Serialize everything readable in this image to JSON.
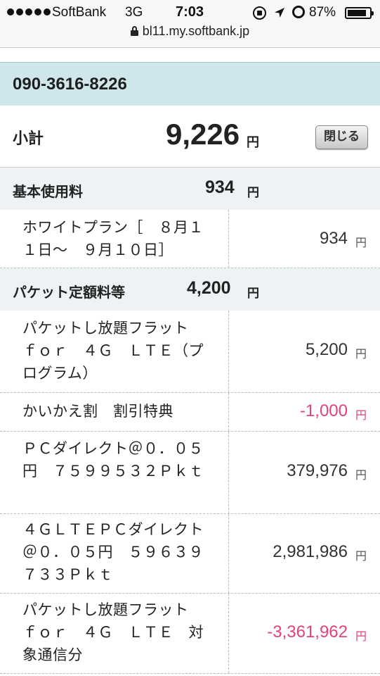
{
  "status_bar": {
    "carrier": "SoftBank",
    "network": "3G",
    "time": "7:03",
    "battery_percent": "87%",
    "battery_level": 0.87,
    "icons": [
      "signal-dots-icon",
      "rotation-lock-icon",
      "location-arrow-icon",
      "alarm-icon",
      "battery-icon"
    ]
  },
  "browser": {
    "url": "bl11.my.softbank.jp",
    "secure_icon": "padlock-icon"
  },
  "bill": {
    "phone_number": "090-3616-8226",
    "subtotal_label": "小計",
    "subtotal_amount": "9,226",
    "subtotal_unit": "円",
    "close_button_label": "閉じる",
    "sections": [
      {
        "label": "基本使用料",
        "amount": "934",
        "unit": "円",
        "items": [
          {
            "name": "ホワイトプラン［　８月１１日～　９月１０日］",
            "amount": "934",
            "unit": "円",
            "negative": false
          }
        ]
      },
      {
        "label": "パケット定額料等",
        "amount": "4,200",
        "unit": "円",
        "items": [
          {
            "name": "パケットし放題フラット　ｆｏｒ　４Ｇ　ＬＴＥ（プログラム）",
            "amount": "5,200",
            "unit": "円",
            "negative": false
          },
          {
            "name": "かいかえ割　割引特典",
            "amount": "-1,000",
            "unit": "円",
            "negative": true
          },
          {
            "name": "ＰＣダイレクト＠０．０５円　７５９９５３２Ｐｋｔ",
            "amount": "379,976",
            "unit": "円",
            "negative": false
          },
          {
            "name": "４ＧＬＴＥＰＣダイレクト＠０．０５円　５９６３９７３３Ｐｋｔ",
            "amount": "2,981,986",
            "unit": "円",
            "negative": false
          },
          {
            "name": "パケットし放題フラット　ｆｏｒ　４Ｇ　ＬＴＥ　対象通信分",
            "amount": "-3,361,962",
            "unit": "円",
            "negative": true
          }
        ]
      }
    ]
  },
  "colors": {
    "phone_header_bg": "#cfe7ea",
    "section_header_bg": "#edf3f5",
    "negative_amount": "#e2427c"
  }
}
